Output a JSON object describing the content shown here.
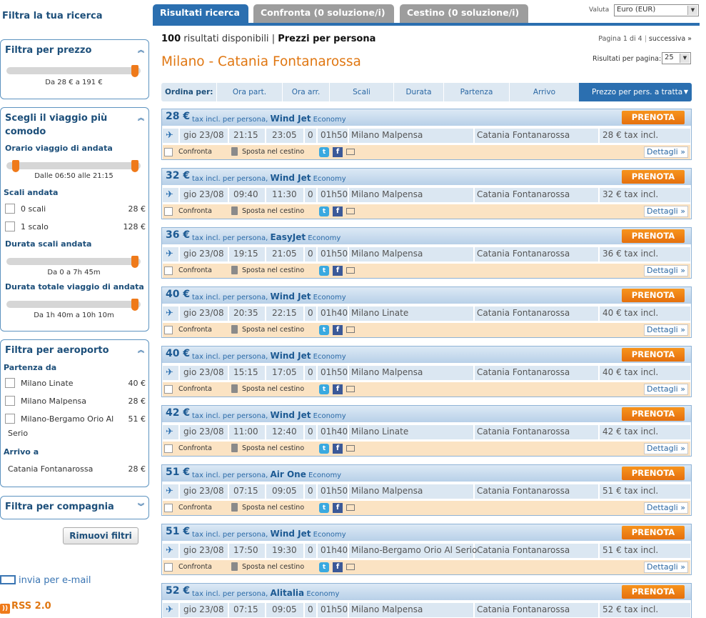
{
  "sidebar": {
    "title": "Filtra la tua ricerca",
    "price_filter": {
      "title": "Filtra per prezzo",
      "caption": "Da 28 € a 191 €"
    },
    "travel_filter": {
      "title": "Scegli il viaggio più comodo",
      "outbound_time_label": "Orario viaggio di andata",
      "outbound_time_caption": "Dalle 06:50 alle 21:15",
      "stops_label": "Scali andata",
      "stops": [
        {
          "label": "0 scali",
          "price": "28 €"
        },
        {
          "label": "1 scalo",
          "price": "128 €"
        }
      ],
      "stop_duration_label": "Durata scali andata",
      "stop_duration_caption": "Da 0 a 7h 45m",
      "total_duration_label": "Durata totale viaggio di andata",
      "total_duration_caption": "Da 1h 40m a 10h 10m"
    },
    "airport_filter": {
      "title": "Filtra per aeroporto",
      "departure_label": "Partenza da",
      "departures": [
        {
          "label": "Milano Linate",
          "price": "40 €"
        },
        {
          "label": "Milano Malpensa",
          "price": "28 €"
        },
        {
          "label": "Milano-Bergamo Orio Al",
          "label2": "Serio",
          "price": "51 €"
        }
      ],
      "arrival_label": "Arrivo a",
      "arrivals": [
        {
          "label": "Catania Fontanarossa",
          "price": "28 €"
        }
      ]
    },
    "airline_filter": {
      "title": "Filtra per compagnia"
    },
    "remove_filters": "Rimuovi filtri",
    "email_link": "invia per e-mail",
    "rss_link": "RSS 2.0"
  },
  "tabs": [
    {
      "label": "Risultati ricerca"
    },
    {
      "label": "Confronta (0 soluzione/i)"
    },
    {
      "label": "Cestino (0 soluzione/i)"
    }
  ],
  "currency": {
    "label": "Valuta",
    "value": "Euro (EUR)"
  },
  "summary": {
    "count": "100",
    "count_text": "risultati disponibili",
    "sep": "|",
    "per_person": "Prezzi per persona"
  },
  "pager": {
    "text": "Pagina 1 di 4",
    "next": "successiva »"
  },
  "route_title": "Milano - Catania Fontanarossa",
  "per_page": {
    "label": "Risultati per pagina:",
    "value": "25"
  },
  "sortbar": {
    "label": "Ordina per:",
    "items": [
      "Ora part.",
      "Ora arr.",
      "Scali",
      "Durata",
      "Partenza",
      "Arrivo"
    ],
    "active": "Prezzo per pers. a tratta"
  },
  "common": {
    "tax_text": "tax incl. per persona,",
    "book": "PRENOTA",
    "compare": "Confronta",
    "basket": "Sposta nel cestino",
    "details": "Dettagli »",
    "date": "gio 23/08",
    "destination": "Catania Fontanarossa"
  },
  "results": [
    {
      "price": "28 €",
      "airline": "Wind Jet",
      "cls": "Economy",
      "dep": "21:15",
      "arr": "23:05",
      "stops": "0",
      "dur": "01h50",
      "from": "Milano Malpensa",
      "total": "28 € tax incl."
    },
    {
      "price": "32 €",
      "airline": "Wind Jet",
      "cls": "Economy",
      "dep": "09:40",
      "arr": "11:30",
      "stops": "0",
      "dur": "01h50",
      "from": "Milano Malpensa",
      "total": "32 € tax incl."
    },
    {
      "price": "36 €",
      "airline": "EasyJet",
      "cls": "Economy",
      "dep": "19:15",
      "arr": "21:05",
      "stops": "0",
      "dur": "01h50",
      "from": "Milano Malpensa",
      "total": "36 € tax incl."
    },
    {
      "price": "40 €",
      "airline": "Wind Jet",
      "cls": "Economy",
      "dep": "20:35",
      "arr": "22:15",
      "stops": "0",
      "dur": "01h40",
      "from": "Milano Linate",
      "total": "40 € tax incl."
    },
    {
      "price": "40 €",
      "airline": "Wind Jet",
      "cls": "Economy",
      "dep": "15:15",
      "arr": "17:05",
      "stops": "0",
      "dur": "01h50",
      "from": "Milano Malpensa",
      "total": "40 € tax incl."
    },
    {
      "price": "42 €",
      "airline": "Wind Jet",
      "cls": "Economy",
      "dep": "11:00",
      "arr": "12:40",
      "stops": "0",
      "dur": "01h40",
      "from": "Milano Linate",
      "total": "42 € tax incl."
    },
    {
      "price": "51 €",
      "airline": "Air One",
      "cls": "Economy",
      "dep": "07:15",
      "arr": "09:05",
      "stops": "0",
      "dur": "01h50",
      "from": "Milano Malpensa",
      "total": "51 € tax incl."
    },
    {
      "price": "51 €",
      "airline": "Wind Jet",
      "cls": "Economy",
      "dep": "17:50",
      "arr": "19:30",
      "stops": "0",
      "dur": "01h40",
      "from": "Milano-Bergamo Orio Al Serio",
      "total": "51 € tax incl."
    },
    {
      "price": "52 €",
      "airline": "Alitalia",
      "cls": "Economy",
      "dep": "07:15",
      "arr": "09:05",
      "stops": "0",
      "dur": "01h50",
      "from": "Milano Malpensa",
      "total": "52 € tax incl."
    }
  ]
}
